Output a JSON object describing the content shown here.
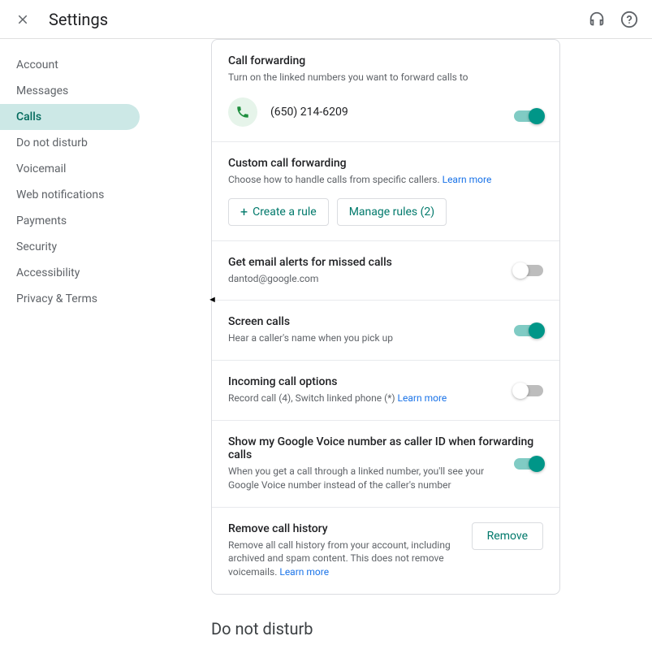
{
  "header": {
    "title": "Settings"
  },
  "sidebar": {
    "items": [
      {
        "label": "Account"
      },
      {
        "label": "Messages"
      },
      {
        "label": "Calls"
      },
      {
        "label": "Do not disturb"
      },
      {
        "label": "Voicemail"
      },
      {
        "label": "Web notifications"
      },
      {
        "label": "Payments"
      },
      {
        "label": "Security"
      },
      {
        "label": "Accessibility"
      },
      {
        "label": "Privacy & Terms"
      }
    ],
    "activeIndex": 2
  },
  "callForwarding": {
    "title": "Call forwarding",
    "sub": "Turn on the linked numbers you want to forward calls to",
    "number": "(650) 214-6209",
    "toggle": true
  },
  "customForwarding": {
    "title": "Custom call forwarding",
    "sub": "Choose how to handle calls from specific callers. ",
    "learn": "Learn more",
    "createRule": "Create a rule",
    "manageRules": "Manage rules (2)"
  },
  "emailAlerts": {
    "title": "Get email alerts for missed calls",
    "sub": "dantod@google.com",
    "toggle": false
  },
  "screenCalls": {
    "title": "Screen calls",
    "sub": "Hear a caller's name when you pick up",
    "toggle": true
  },
  "incoming": {
    "title": "Incoming call options",
    "sub": "Record call (4), Switch linked phone (*) ",
    "learn": "Learn more",
    "toggle": false
  },
  "callerId": {
    "title": "Show my Google Voice number as caller ID when forwarding calls",
    "sub": "When you get a call through a linked number, you'll see your Google Voice number instead of the caller's number",
    "toggle": true
  },
  "removeHistory": {
    "title": "Remove call history",
    "sub": "Remove all call history from your account, including archived and spam content. This does not remove voicemails. ",
    "learn": "Learn more",
    "button": "Remove"
  },
  "nextSection": "Do not disturb"
}
